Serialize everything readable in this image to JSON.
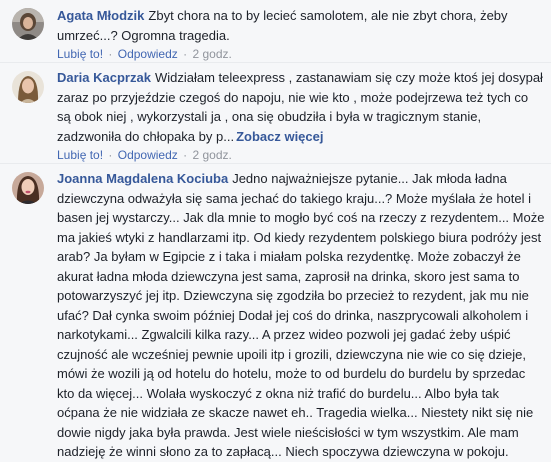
{
  "comments": [
    {
      "author": "Agata Młodzik",
      "text": "Zbyt chora na to by lecieć samolotem, ale nie zbyt chora, żeby umrzeć...? Ogromna tragedia.",
      "see_more": "",
      "like_label": "Lubię to!",
      "reply_label": "Odpowiedz",
      "timestamp": "2 godz."
    },
    {
      "author": "Daria Kacprzak",
      "text": "Widziałam teleexpress , zastanawiam się czy może ktoś jej dosypał zaraz po przyjeździe czegoś do napoju, nie wie kto , może podejrzewa też tych co są obok niej , wykorzystali ja , ona się obudziła i była w tragicznym stanie, zadzwoniła do chłopaka by p...",
      "see_more": "Zobacz więcej",
      "like_label": "Lubię to!",
      "reply_label": "Odpowiedz",
      "timestamp": "2 godz."
    },
    {
      "author": "Joanna Magdalena Kociuba",
      "text": "Jedno najważniejsze pytanie... Jak młoda ładna dziewczyna odważyła się sama jechać do takiego kraju...? Może myślała że hotel i basen jej wystarczy... Jak dla mnie to mogło być coś na rzeczy z rezydentem... Może ma jakieś wtyki z handlarzami itp. Od kiedy rezydentem polskiego biura podróży jest arab? Ja byłam w Egipcie z i taka i miałam polska rezydentkę. Może zobaczył że akurat ładna młoda dziewczyna jest sama, zaprosił na drinka, skoro jest sama to potowarzyszyć jej itp. Dziewczyna się zgodziła bo przecież to rezydent, jak mu nie ufać? Dał cynka swoim później Dodał jej coś do drinka, naszprycowali alkoholem i narkotykami... Zgwalcili kilka razy... A przez wideo pozwoli jej gadać żeby uśpić czujność ale wcześniej pewnie upoili itp i grozili, dziewczyna nie wie co się dzieje, mówi że wozili ją od hotelu do hotelu, może to od burdelu do burdelu by sprzedac kto da więcej... Wolała wyskoczyć z okna niż trafić do burdelu... Albo była tak oćpana że nie widziała ze skacze nawet eh.. Tragedia wielka... Niestety nikt się nie dowie nigdy jaka była prawda. Jest wiele nieścisłości w tym wszystkim. Ale mam nadzieję że winni słono za to zapłacą... Niech spoczywa dziewczyna w pokoju.",
      "see_more": ""
    }
  ],
  "separator": "·",
  "colors": {
    "background": "#f6f7f9",
    "author": "#365899",
    "link": "#4267b2",
    "meta": "#90949c",
    "text": "#1d2129"
  }
}
